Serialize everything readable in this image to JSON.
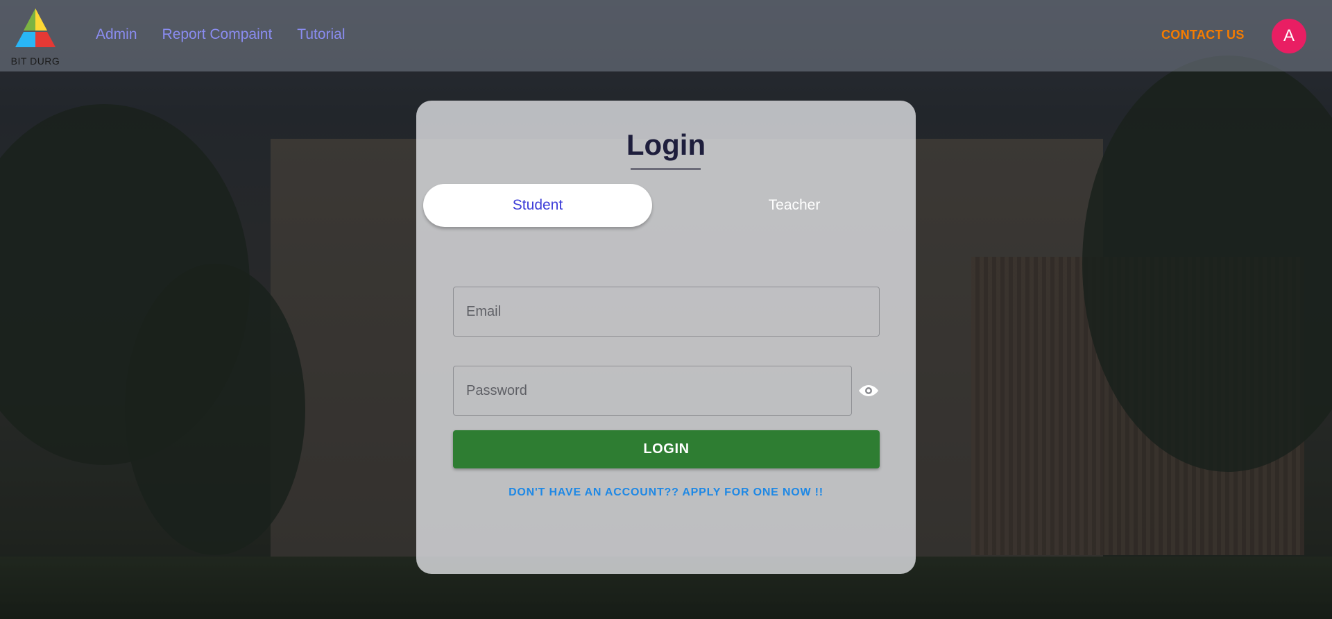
{
  "brand": {
    "logo_text": "BIT DURG"
  },
  "nav": {
    "links": [
      "Admin",
      "Report Compaint",
      "Tutorial"
    ],
    "contact_label": "CONTACT US",
    "avatar_letter": "A"
  },
  "login": {
    "title": "Login",
    "tabs": {
      "student": "Student",
      "teacher": "Teacher",
      "active": "Student"
    },
    "email_placeholder": "Email",
    "password_placeholder": "Password",
    "submit_label": "LOGIN",
    "apply_link": "DON'T HAVE AN ACCOUNT?? APPLY FOR ONE NOW !!"
  },
  "colors": {
    "accent": "#3d3dd8",
    "contact": "#f57c00",
    "avatar": "#e91e63",
    "login_button": "#2e7d32",
    "link": "#1e88e5"
  }
}
